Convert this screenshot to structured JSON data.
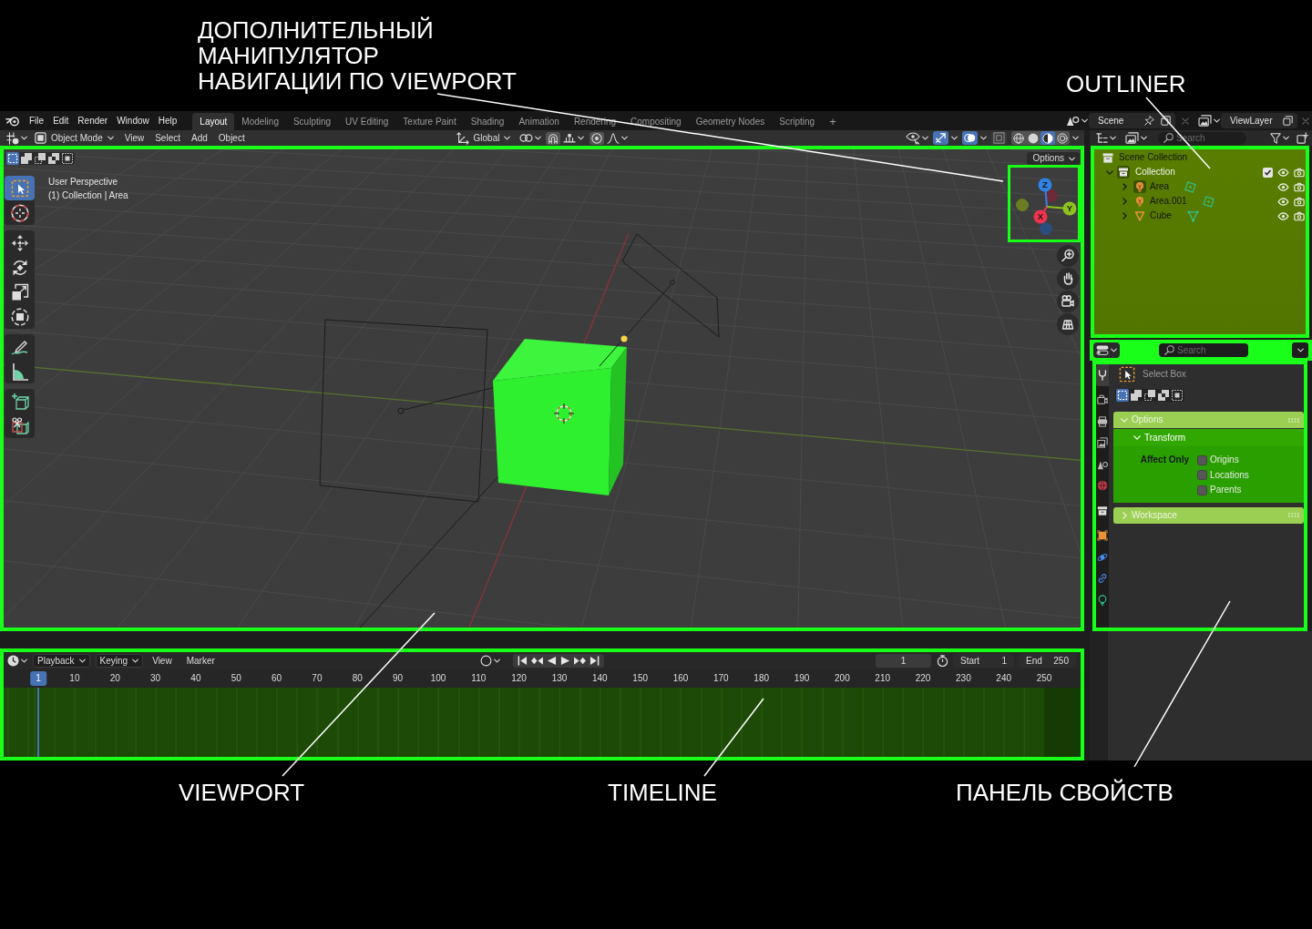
{
  "callouts_top": [
    {
      "lines": [
        "ДОПОЛНИТЕЛЬНЫЙ",
        "МАНИПУЛЯТОР",
        "НАВИГАЦИИ ПО VIEWPORT"
      ]
    },
    {
      "lines": [
        "OUTLINER"
      ]
    }
  ],
  "topbar": {
    "menu": [
      "File",
      "Edit",
      "Render",
      "Window",
      "Help"
    ],
    "workspaces": [
      {
        "label": "Layout",
        "selected": true
      },
      {
        "label": "Modeling",
        "selected": false
      },
      {
        "label": "Sculpting",
        "selected": false
      },
      {
        "label": "UV Editing",
        "selected": false
      },
      {
        "label": "Texture Paint",
        "selected": false
      },
      {
        "label": "Shading",
        "selected": false
      },
      {
        "label": "Animation",
        "selected": false
      },
      {
        "label": "Rendering",
        "selected": false
      },
      {
        "label": "Compositing",
        "selected": false
      },
      {
        "label": "Geometry Nodes",
        "selected": false
      },
      {
        "label": "Scripting",
        "selected": false
      }
    ],
    "add_workspace": "+",
    "scene": "Scene",
    "view_layer": "ViewLayer"
  },
  "viewport": {
    "header": {
      "mode": "Object Mode",
      "menus": [
        "View",
        "Select",
        "Add",
        "Object"
      ],
      "orientation": "Global",
      "toggles": [
        {
          "kind": "gizmos",
          "on": true
        },
        {
          "kind": "overlays",
          "on": true
        },
        {
          "kind": "xray",
          "on": false
        }
      ],
      "shading": [
        {
          "kind": "wireframe",
          "selected": false
        },
        {
          "kind": "solid",
          "selected": false
        },
        {
          "kind": "material",
          "selected": true
        },
        {
          "kind": "rendered",
          "selected": false
        }
      ]
    },
    "select_modes": [
      {
        "kind": "set",
        "selected": true
      },
      {
        "kind": "extend",
        "selected": false
      },
      {
        "kind": "subtract",
        "selected": false
      },
      {
        "kind": "difference",
        "selected": false
      },
      {
        "kind": "intersect",
        "selected": false
      }
    ],
    "tool_groups": [
      [
        {
          "kind": "select_box",
          "selected": true
        },
        {
          "kind": "cursor",
          "selected": false
        }
      ],
      [
        {
          "kind": "move",
          "selected": false
        },
        {
          "kind": "rotate",
          "selected": false
        },
        {
          "kind": "scale",
          "selected": false
        },
        {
          "kind": "transform",
          "selected": false
        }
      ],
      [
        {
          "kind": "annotate",
          "selected": false
        },
        {
          "kind": "measure",
          "selected": false
        }
      ],
      [
        {
          "kind": "add_cube",
          "selected": false
        },
        {
          "kind": "cut_cube",
          "selected": false
        }
      ]
    ],
    "info": [
      "User Perspective",
      "(1) Collection | Area"
    ],
    "options": "Options",
    "gizmo_axes": [
      {
        "kind": "negative",
        "color": "#6e2a38"
      },
      {
        "kind": "negative",
        "color": "#2c4e7e"
      },
      {
        "kind": "negative",
        "color": "#6a7d22"
      },
      {
        "kind": "positive",
        "label": "Z",
        "color": "#2f83e6"
      },
      {
        "kind": "positive",
        "label": "Y",
        "color": "#8cc21e"
      },
      {
        "kind": "positive",
        "label": "X",
        "color": "#f0344e"
      }
    ],
    "nav_buttons": [
      {
        "kind": "zoom"
      },
      {
        "kind": "pan"
      },
      {
        "kind": "camera"
      },
      {
        "kind": "ortho"
      }
    ]
  },
  "timeline": {
    "menus": [
      {
        "label": "Playback",
        "dropdown": true
      },
      {
        "label": "Keying",
        "dropdown": true
      },
      {
        "label": "View",
        "dropdown": false
      },
      {
        "label": "Marker",
        "dropdown": false
      }
    ],
    "current_frame": "1",
    "start_label": "Start",
    "start": "1",
    "end_label": "End",
    "end": "250",
    "ruler": [
      {
        "label": "1",
        "selected": true
      },
      {
        "label": "10",
        "selected": false
      },
      {
        "label": "20",
        "selected": false
      },
      {
        "label": "30",
        "selected": false
      },
      {
        "label": "40",
        "selected": false
      },
      {
        "label": "50",
        "selected": false
      },
      {
        "label": "60",
        "selected": false
      },
      {
        "label": "70",
        "selected": false
      },
      {
        "label": "80",
        "selected": false
      },
      {
        "label": "90",
        "selected": false
      },
      {
        "label": "100",
        "selected": false
      },
      {
        "label": "110",
        "selected": false
      },
      {
        "label": "120",
        "selected": false
      },
      {
        "label": "130",
        "selected": false
      },
      {
        "label": "140",
        "selected": false
      },
      {
        "label": "150",
        "selected": false
      },
      {
        "label": "160",
        "selected": false
      },
      {
        "label": "170",
        "selected": false
      },
      {
        "label": "180",
        "selected": false
      },
      {
        "label": "190",
        "selected": false
      },
      {
        "label": "200",
        "selected": false
      },
      {
        "label": "210",
        "selected": false
      },
      {
        "label": "220",
        "selected": false
      },
      {
        "label": "230",
        "selected": false
      },
      {
        "label": "240",
        "selected": false
      },
      {
        "label": "250",
        "selected": false
      }
    ]
  },
  "outliner": {
    "search": {
      "placeholder": "Search"
    },
    "root": "Scene Collection",
    "items": [
      {
        "name": "Collection",
        "kind": "collection",
        "expanded": true,
        "selected": true,
        "checked": true,
        "children": [
          {
            "name": "Area",
            "kind": "light",
            "expanded": false,
            "selected": true
          },
          {
            "name": "Area.001",
            "kind": "light",
            "expanded": false,
            "selected": false
          },
          {
            "name": "Cube",
            "kind": "mesh",
            "expanded": false,
            "selected": false
          }
        ]
      }
    ]
  },
  "properties": {
    "search": {
      "placeholder": "Search"
    },
    "tab_groups": [
      [
        {
          "kind": "tool",
          "selected": true
        }
      ],
      [
        {
          "kind": "render",
          "selected": false
        },
        {
          "kind": "output",
          "selected": false
        },
        {
          "kind": "view_layer",
          "selected": false
        },
        {
          "kind": "scene",
          "selected": false
        },
        {
          "kind": "world",
          "selected": false
        }
      ],
      [
        {
          "kind": "collection",
          "selected": false
        }
      ],
      [
        {
          "kind": "object",
          "selected": false
        },
        {
          "kind": "physics",
          "selected": false
        },
        {
          "kind": "constraints",
          "selected": false
        },
        {
          "kind": "data",
          "selected": false
        }
      ]
    ],
    "tool_name": "Select Box",
    "select_modes": [
      {
        "kind": "set",
        "selected": true
      },
      {
        "kind": "extend",
        "selected": false
      },
      {
        "kind": "subtract",
        "selected": false
      },
      {
        "kind": "difference",
        "selected": false
      },
      {
        "kind": "intersect",
        "selected": false
      }
    ],
    "panels": [
      {
        "title": "Options",
        "expanded": true,
        "subpanels": [
          {
            "title": "Transform",
            "expanded": true,
            "field_label": "Affect Only",
            "options": [
              {
                "label": "Origins",
                "checked": false
              },
              {
                "label": "Locations",
                "checked": false
              },
              {
                "label": "Parents",
                "checked": false
              }
            ]
          }
        ]
      },
      {
        "title": "Workspace",
        "expanded": false
      }
    ]
  },
  "callouts_bottom": [
    {
      "lines": [
        "VIEWPORT"
      ]
    },
    {
      "lines": [
        "TIMELINE"
      ]
    },
    {
      "lines": [
        "ПАНЕЛЬ СВОЙСТВ"
      ]
    }
  ]
}
